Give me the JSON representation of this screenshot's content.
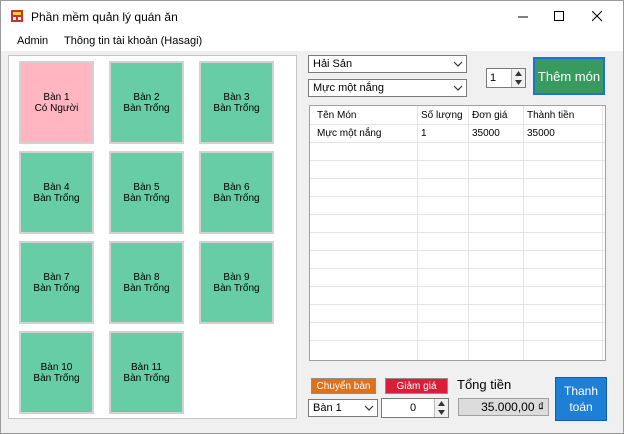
{
  "window": {
    "title": "Phần mềm quản lý quán ăn"
  },
  "menu": {
    "admin": "Admin",
    "account": "Thông tin tài khoản (Hasagi)"
  },
  "tables": [
    {
      "name": "Bàn 1",
      "status": "Có Người"
    },
    {
      "name": "Bàn 2",
      "status": "Bàn Trống"
    },
    {
      "name": "Bàn 3",
      "status": "Bàn Trống"
    },
    {
      "name": "Bàn 4",
      "status": "Bàn Trống"
    },
    {
      "name": "Bàn 5",
      "status": "Bàn Trống"
    },
    {
      "name": "Bàn 6",
      "status": "Bàn Trống"
    },
    {
      "name": "Bàn 7",
      "status": "Bàn Trống"
    },
    {
      "name": "Bàn 8",
      "status": "Bàn Trống"
    },
    {
      "name": "Bàn 9",
      "status": "Bàn Trống"
    },
    {
      "name": "Bàn 10",
      "status": "Bàn Trống"
    },
    {
      "name": "Bàn 11",
      "status": "Bàn Trống"
    }
  ],
  "order": {
    "category": "Hải Sản",
    "food": "Mực một nắng",
    "quantity": "1",
    "add_button": "Thêm món"
  },
  "bill": {
    "columns": [
      "Tên Món",
      "Số lượng",
      "Đơn giá",
      "Thành tiền"
    ],
    "rows": [
      [
        "Mực một nắng",
        "1",
        "35000",
        "35000"
      ]
    ]
  },
  "footer": {
    "switch_button": "Chuyển bàn",
    "discount_button": "Giảm giá",
    "switch_table": "Bàn 1",
    "discount_value": "0",
    "total_label": "Tổng tiền",
    "total_value": "35.000,00 ₫",
    "pay_line1": "Thanh",
    "pay_line2": "toán"
  },
  "colors": {
    "empty_table": "#66cda6",
    "occupied_table": "#ffb6c1",
    "add_button": "#399a5f",
    "pay_button": "#1e7fd6",
    "switch_button": "#e0711c",
    "discount_button": "#d71f3c"
  },
  "icons": {
    "app": "restaurant-app-icon",
    "minimize": "minimize-icon",
    "maximize": "maximize-icon",
    "close": "close-icon"
  }
}
